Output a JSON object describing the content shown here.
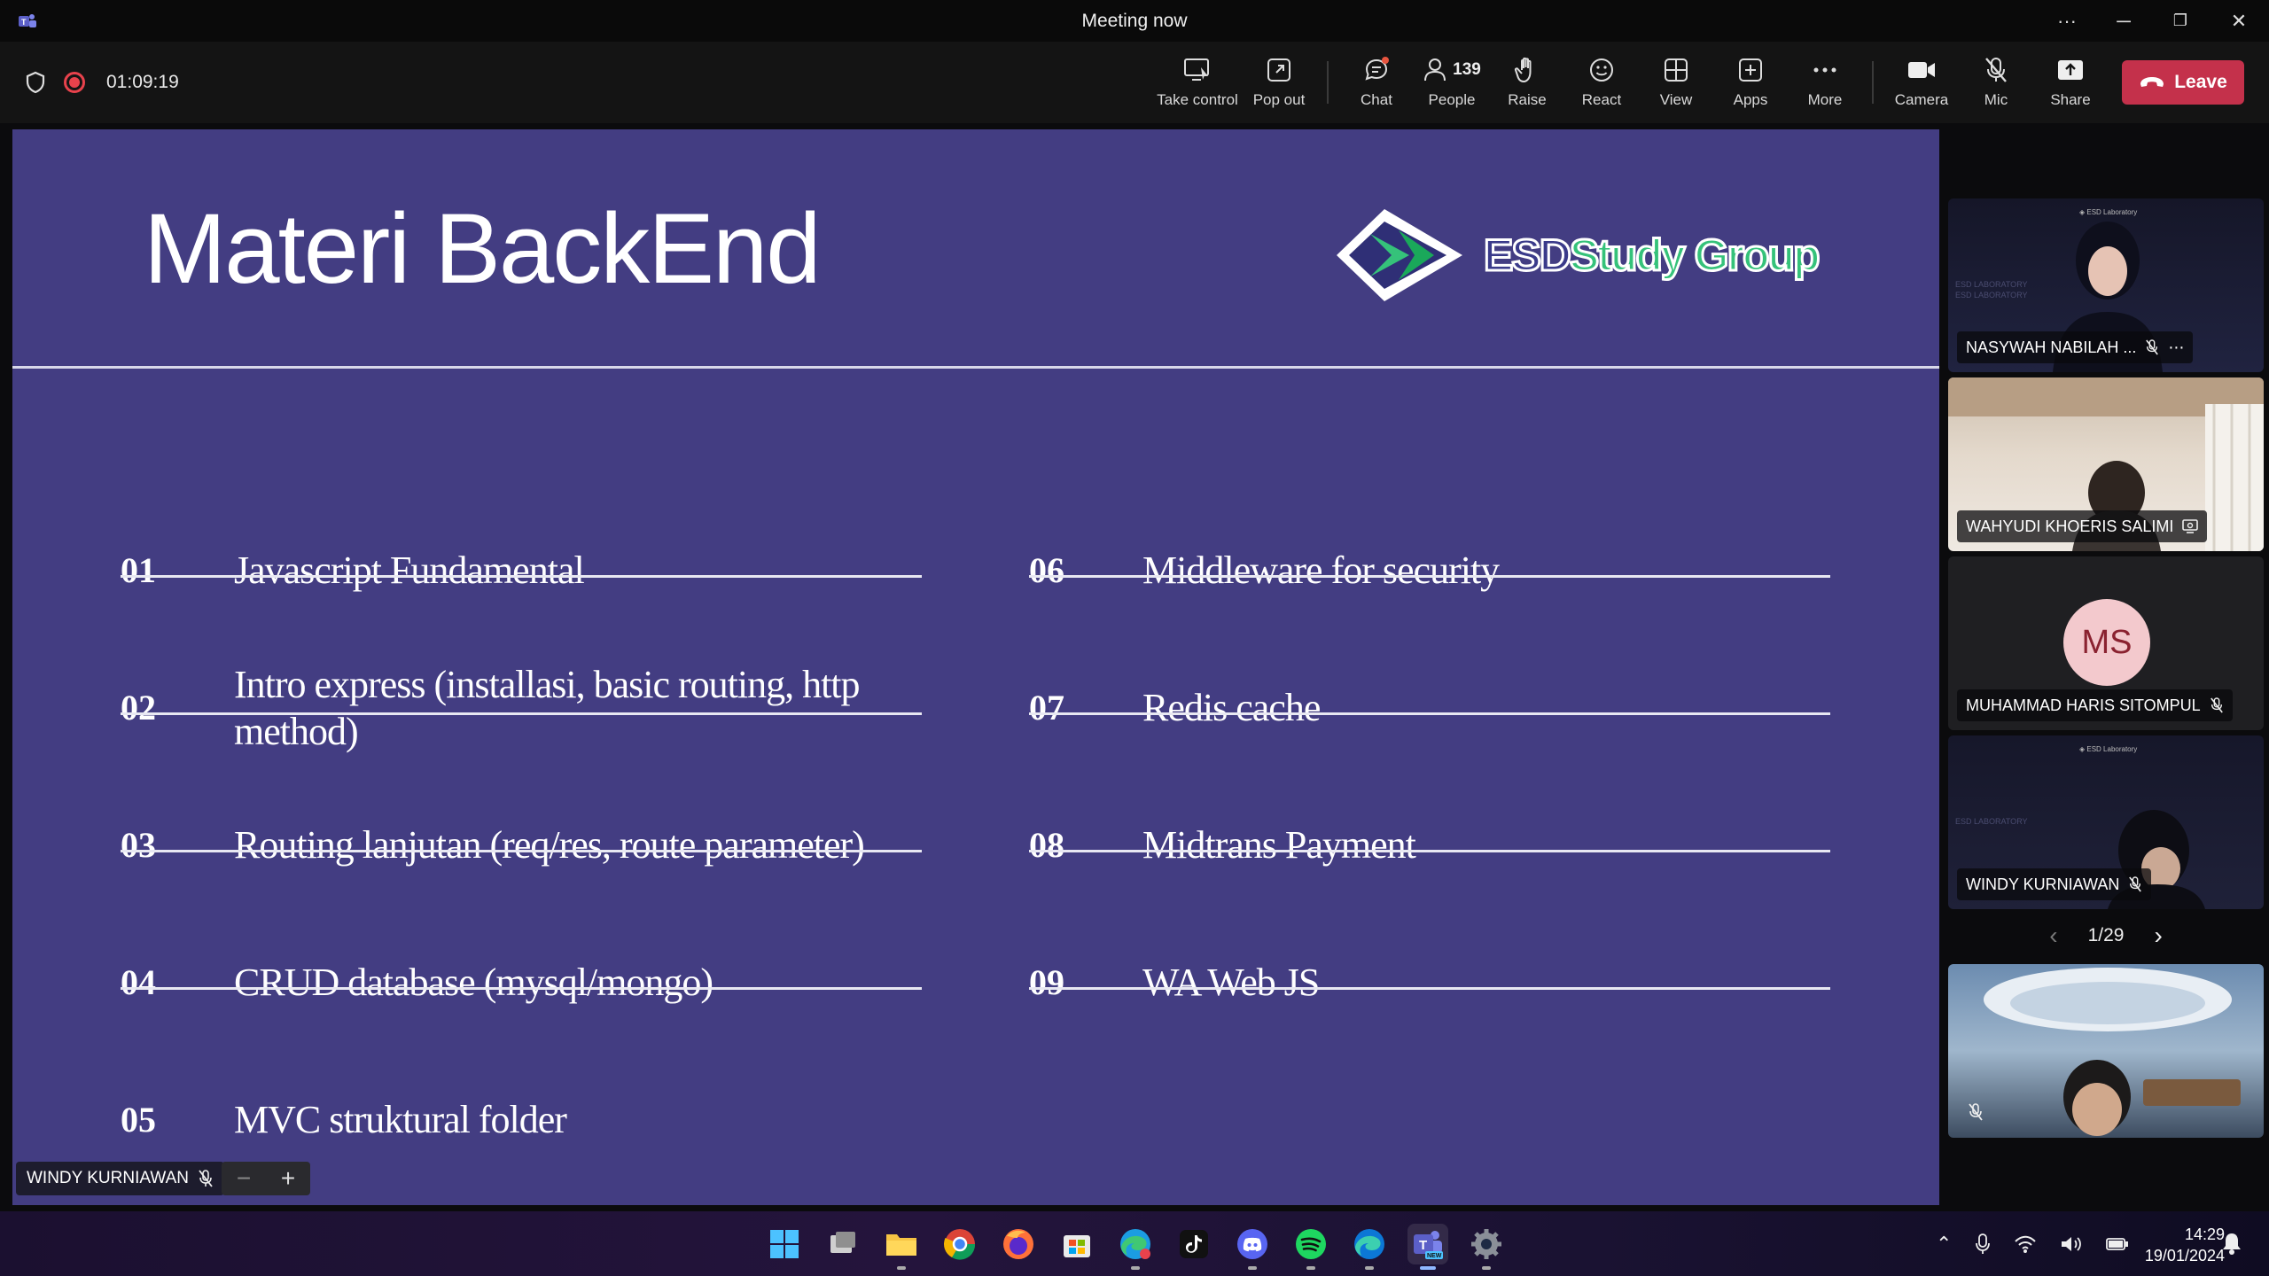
{
  "window": {
    "title": "Meeting now",
    "controls": {
      "more": "···",
      "minimize": "─",
      "restore": "❐",
      "close": "✕"
    }
  },
  "meeting_bar": {
    "elapsed": "01:09:19",
    "tools": [
      {
        "label": "Take control",
        "icon": "take-control-icon"
      },
      {
        "label": "Pop out",
        "icon": "pop-out-icon"
      },
      {
        "label": "Chat",
        "icon": "chat-icon"
      },
      {
        "label": "People",
        "icon": "people-icon",
        "count": "139"
      },
      {
        "label": "Raise",
        "icon": "raise-hand-icon"
      },
      {
        "label": "React",
        "icon": "react-icon"
      },
      {
        "label": "View",
        "icon": "view-icon"
      },
      {
        "label": "Apps",
        "icon": "apps-icon"
      },
      {
        "label": "More",
        "icon": "more-icon"
      },
      {
        "label": "Camera",
        "icon": "camera-icon"
      },
      {
        "label": "Mic",
        "icon": "mic-off-icon"
      },
      {
        "label": "Share",
        "icon": "share-icon"
      }
    ],
    "leave_label": "Leave",
    "leave_color": "#c4314b"
  },
  "slide": {
    "title": "Materi BackEnd",
    "logo": {
      "part1": "ESD",
      "part2": "Study Group"
    },
    "background": "#433d82",
    "topics": [
      {
        "num": "01",
        "text": "Javascript Fundamental"
      },
      {
        "num": "02",
        "text": "Intro express (installasi, basic routing, http method)"
      },
      {
        "num": "03",
        "text": "Routing lanjutan (req/res, route parameter)"
      },
      {
        "num": "04",
        "text": "CRUD database (mysql/mongo)"
      },
      {
        "num": "05",
        "text": "MVC struktural folder"
      },
      {
        "num": "06",
        "text": "Middleware for security"
      },
      {
        "num": "07",
        "text": "Redis cache"
      },
      {
        "num": "08",
        "text": "Midtrans Payment"
      },
      {
        "num": "09",
        "text": "WA Web JS"
      }
    ]
  },
  "presenter": {
    "name": "WINDY KURNIAWAN",
    "zoom_out": "−",
    "zoom_in": "+"
  },
  "participants": [
    {
      "name": "NASYWAH NABILAH ...",
      "type": "video"
    },
    {
      "name": "WAHYUDI KHOERIS SALIMI",
      "type": "video"
    },
    {
      "name": "MUHAMMAD HARIS SITOMPUL",
      "type": "avatar",
      "initials": "MS"
    },
    {
      "name": "WINDY KURNIAWAN",
      "type": "video"
    }
  ],
  "pager": {
    "label": "1/29",
    "prev": "‹",
    "next": "›"
  },
  "taskbar": {
    "apps": [
      "start-icon",
      "task-view-icon",
      "file-explorer-icon",
      "chrome-icon",
      "firefox-icon",
      "store-icon",
      "edge-beta-icon",
      "tiktok-icon",
      "discord-icon",
      "spotify-icon",
      "edge-icon",
      "teams-icon",
      "settings-icon"
    ],
    "clock_time": "14:29",
    "clock_date": "19/01/2024"
  }
}
